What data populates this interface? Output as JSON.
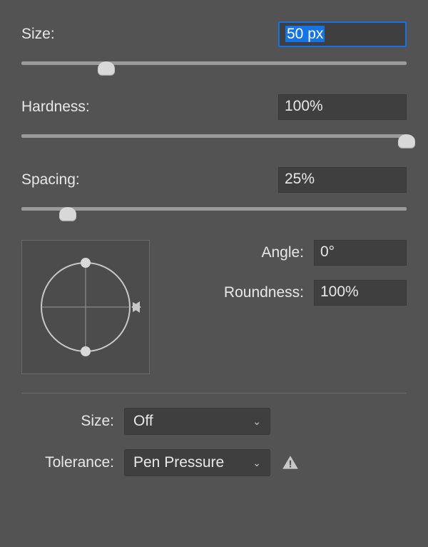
{
  "size": {
    "label": "Size:",
    "value": "50 px",
    "slider_percent": 22
  },
  "hardness": {
    "label": "Hardness:",
    "value": "100%",
    "slider_percent": 100
  },
  "spacing": {
    "label": "Spacing:",
    "value": "25%",
    "slider_percent": 12
  },
  "angle": {
    "label": "Angle:",
    "value": "0°"
  },
  "roundness": {
    "label": "Roundness:",
    "value": "100%"
  },
  "dyn_size": {
    "label": "Size:",
    "value": "Off"
  },
  "tolerance": {
    "label": "Tolerance:",
    "value": "Pen Pressure"
  }
}
